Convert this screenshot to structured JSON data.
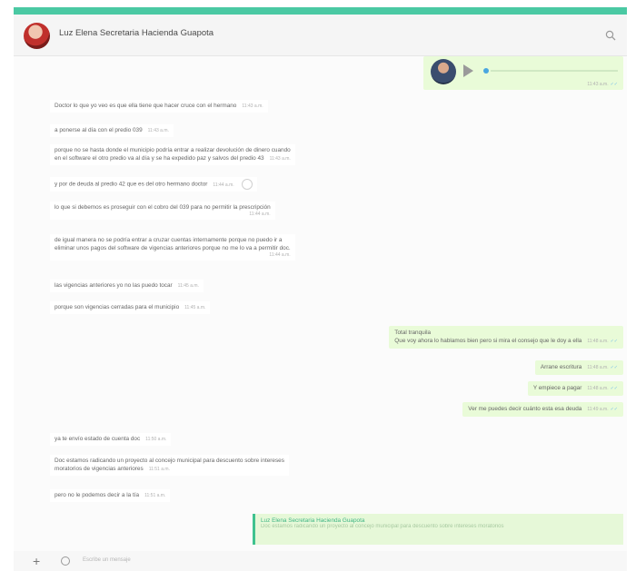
{
  "header": {
    "contact_name": "Luz Elena Secretaria Hacienda Guapota"
  },
  "colors": {
    "accent": "#4ac9a3",
    "outgoing_bubble": "#e9fbd8",
    "read_ticks": "#7ac2e8"
  },
  "icons": {
    "search": "search-icon",
    "attach": "plus-icon",
    "emoji": "emoji-icon",
    "play": "play-icon"
  },
  "voice_note": {
    "time": "11:43 a.m."
  },
  "messages": [
    {
      "text": "Doctor lo que yo veo es que ella tiene que hacer cruce con el hermano",
      "time": "11:43 a.m."
    },
    {
      "text": "a ponerse al día con el predio 039",
      "time": "11:43 a.m."
    },
    {
      "line1": "porque no se hasta donde el municipio podría entrar a realizar devolución de dinero cuando",
      "line2": "en el software el otro predio va al día y se ha expedido paz y salvos del predio 43",
      "time": "11:43 a.m."
    },
    {
      "text": "y por de deuda al predio 42 que es del otro hermano doctor",
      "time": "11:44 a.m."
    },
    {
      "text": "lo que si debemos es proseguir con el cobro del 039 para no permitir la prescripción",
      "time": "11:44 a.m."
    },
    {
      "line1": "de igual manera no se podría entrar a cruzar cuentas internamente porque no puedo ir a",
      "line2": "eliminar unos pagos del software de vigencias anteriores porque no me lo va a permitir doc.",
      "time": "11:44 a.m."
    },
    {
      "text": "las vigencias anteriores yo no las puedo tocar",
      "time": "11:45 a.m."
    },
    {
      "text": "porque son vigencias cerradas para el municipio",
      "time": "11:45 a.m."
    }
  ],
  "outgoing": [
    {
      "line1": "Total tranquila",
      "line2": "Que voy ahora lo hablamos bien pero si mira el consejo que le doy a ella",
      "time": "11:48 a.m."
    },
    {
      "text": "Arrane escritura",
      "time": "11:48 a.m."
    },
    {
      "text": "Y empiece a pagar",
      "time": "11:48 a.m."
    },
    {
      "text": "Ver me puedes decir cuánto esta esa deuda",
      "time": "11:49 a.m."
    }
  ],
  "later_messages": [
    {
      "text": "ya te envío estado de cuenta doc",
      "time": "11:50 a.m."
    },
    {
      "line1": "Doc estamos radicando un proyecto al concejo municipal para descuento sobre intereses",
      "line2": "moratorios de vigencias anteriores",
      "time": "11:51 a.m."
    },
    {
      "text": "pero no le podemos decir a la tía",
      "time": "11:51 a.m."
    }
  ],
  "reply_quote": {
    "author": "Luz Elena Secretaria Hacienda Guapota",
    "text": "Doc estamos radicando un proyecto al concejo municipal para descuento sobre intereses moratorios"
  },
  "footer": {
    "placeholder": "Escribe un mensaje"
  }
}
